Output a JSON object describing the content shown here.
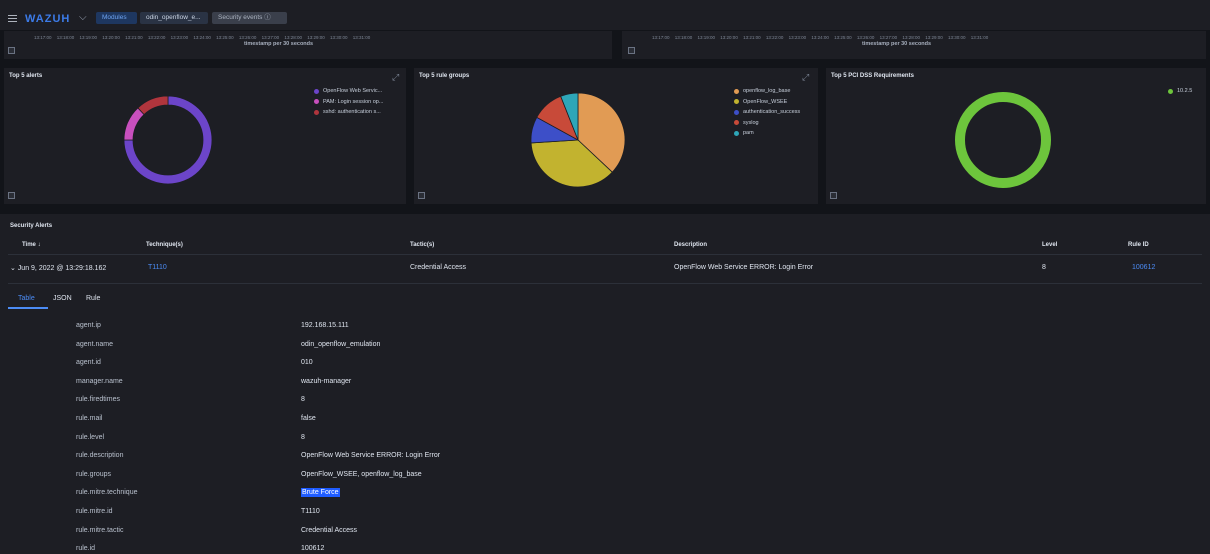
{
  "topbar": {
    "logo": "WAZUH",
    "breadcrumb": {
      "modules": "Modules",
      "agent": "odin_openflow_e...",
      "current": "Security events ⓘ"
    }
  },
  "histograms": {
    "left": {
      "ticks": "13:17:00 13:18:00 13:19:00 13:20:00 13:21:00 13:22:00 13:23:00 13:24:00 13:25:00 13:26:00 13:27:00 13:28:00 13:29:00 13:30:00 13:31:00",
      "axis_title": "timestamp per 30 seconds"
    },
    "right": {
      "ticks": "13:17:00 13:18:00 13:19:00 13:20:00 13:21:00 13:22:00 13:23:00 13:24:00 13:25:00 13:26:00 13:27:00 13:28:00 13:29:00 13:30:00 13:31:00",
      "axis_title": "timestamp per 30 seconds"
    }
  },
  "widgets": {
    "top_alerts": {
      "title": "Top 5 alerts",
      "legend": [
        {
          "label": "OpenFlow Web Servic...",
          "color": "#6c45c9"
        },
        {
          "label": "PAM: Login session op...",
          "color": "#c84fbd"
        },
        {
          "label": "sshd: authentication s...",
          "color": "#b0353d"
        }
      ]
    },
    "top_rule_groups": {
      "title": "Top 5 rule groups",
      "legend": [
        {
          "label": "openflow_log_base",
          "color": "#e19b54"
        },
        {
          "label": "OpenFlow_WSEE",
          "color": "#c2b32f"
        },
        {
          "label": "authentication_success",
          "color": "#3d4fc8"
        },
        {
          "label": "syslog",
          "color": "#c84a39"
        },
        {
          "label": "pam",
          "color": "#2ea6b8"
        }
      ]
    },
    "top_pci": {
      "title": "Top 5 PCI DSS Requirements",
      "legend": [
        {
          "label": "10.2.5",
          "color": "#6dc53c"
        }
      ]
    }
  },
  "chart_data": [
    {
      "type": "pie",
      "title": "Top 5 alerts",
      "categories": [
        "OpenFlow Web Servic...",
        "PAM: Login session op...",
        "sshd: authentication s..."
      ],
      "values": [
        75,
        13,
        12
      ],
      "donut": true
    },
    {
      "type": "pie",
      "title": "Top 5 rule groups",
      "categories": [
        "openflow_log_base",
        "OpenFlow_WSEE",
        "authentication_success",
        "syslog",
        "pam"
      ],
      "values": [
        37,
        37,
        9,
        11,
        6
      ],
      "donut": false
    },
    {
      "type": "pie",
      "title": "Top 5 PCI DSS Requirements",
      "categories": [
        "10.2.5"
      ],
      "values": [
        100
      ],
      "donut": true
    }
  ],
  "security_alerts": {
    "title": "Security Alerts",
    "columns": {
      "time": "Time ↓",
      "technique": "Technique(s)",
      "tactic": "Tactic(s)",
      "description": "Description",
      "level": "Level",
      "rule_id": "Rule ID"
    },
    "row": {
      "time": "⌄ Jun 9, 2022 @ 13:29:18.162",
      "technique": "T1110",
      "tactic": "Credential Access",
      "description": "OpenFlow Web Service ERROR: Login Error",
      "level": "8",
      "rule_id": "100612"
    },
    "tabs": {
      "table": "Table",
      "json": "JSON",
      "rule": "Rule"
    },
    "details": [
      {
        "key": "agent.ip",
        "value": "192.168.15.111"
      },
      {
        "key": "agent.name",
        "value": "odin_openflow_emulation"
      },
      {
        "key": "agent.id",
        "value": "010"
      },
      {
        "key": "manager.name",
        "value": "wazuh-manager"
      },
      {
        "key": "rule.firedtimes",
        "value": "8"
      },
      {
        "key": "rule.mail",
        "value": "false"
      },
      {
        "key": "rule.level",
        "value": "8"
      },
      {
        "key": "rule.description",
        "value": "OpenFlow Web Service ERROR: Login Error"
      },
      {
        "key": "rule.groups",
        "value": "OpenFlow_WSEE, openflow_log_base"
      },
      {
        "key": "rule.mitre.technique",
        "value": "Brute Force"
      },
      {
        "key": "rule.mitre.id",
        "value": "T1110"
      },
      {
        "key": "rule.mitre.tactic",
        "value": "Credential Access"
      },
      {
        "key": "rule.id",
        "value": "100612"
      }
    ]
  }
}
